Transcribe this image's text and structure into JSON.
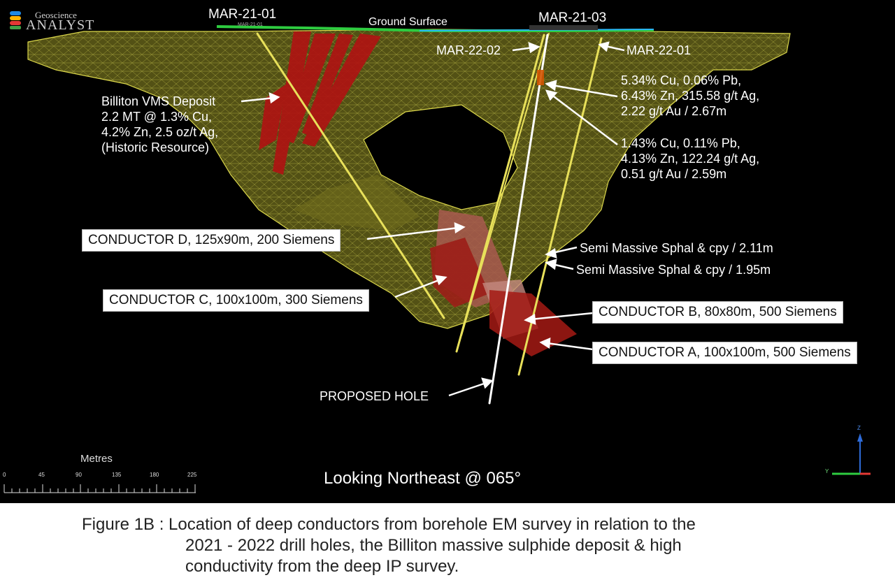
{
  "logo": {
    "line1": "Geoscience",
    "line2": "ANALYST"
  },
  "labels": {
    "ground_surface": "Ground Surface",
    "mar_21_01": "MAR-21-01",
    "mar_21_01_small": "MAR-21-01",
    "mar_21_03": "MAR-21-03",
    "mar_22_02": "MAR-22-02",
    "mar_22_01": "MAR-22-01",
    "billiton": [
      "Billiton VMS Deposit",
      "2.2 MT @ 1.3% Cu,",
      "4.2% Zn, 2.5 oz/t Ag,",
      "(Historic Resource)"
    ],
    "assay1": [
      "5.34% Cu, 0.06% Pb,",
      "6.43% Zn, 315.58 g/t Ag,",
      "2.22 g/t Au / 2.67m"
    ],
    "assay2": [
      "1.43% Cu, 0.11% Pb,",
      "4.13% Zn, 122.24 g/t Ag,",
      "0.51 g/t Au / 2.59m"
    ],
    "semi1": "Semi Massive Sphal & cpy / 2.11m",
    "semi2": "Semi Massive Sphal & cpy / 1.95m",
    "cond_d": "CONDUCTOR D, 125x90m, 200 Siemens",
    "cond_c": "CONDUCTOR C, 100x100m, 300 Siemens",
    "cond_b": "CONDUCTOR B, 80x80m, 500 Siemens",
    "cond_a": "CONDUCTOR A, 100x100m, 500 Siemens",
    "proposed": "PROPOSED HOLE",
    "view": "Looking Northeast @ 065°"
  },
  "scale": {
    "title": "Metres",
    "ticks": [
      "0",
      "45",
      "90",
      "135",
      "180",
      "225"
    ]
  },
  "axes": {
    "z": "Z",
    "y": "Y"
  },
  "caption": {
    "line1": "Figure 1B : Location of deep conductors from borehole EM survey in relation to the",
    "line2": "2021 - 2022 drill holes, the Billiton massive sulphide deposit & high",
    "line3": "conductivity from the deep IP survey."
  },
  "colors": {
    "mesh": "#b8b431",
    "deposit": "#b01212",
    "conductor": "#a51a14",
    "drillhole": "#e8e05a",
    "ground": "#2ecc40"
  }
}
